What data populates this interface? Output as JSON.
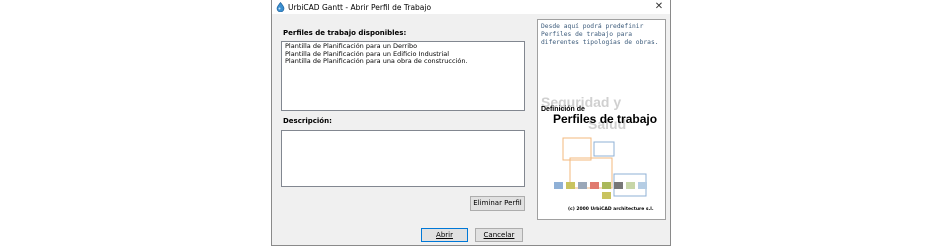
{
  "window": {
    "title": "UrbiCAD Gantt - Abrir Perfil de Trabajo",
    "close_glyph": "✕"
  },
  "profiles": {
    "label": "Perfiles de trabajo disponibles:",
    "items": [
      "Plantilla de Planificación para un Derribo",
      "Plantilla de Planificación para un Edificio Industrial",
      "Plantilla de Planificación para una obra de construcción."
    ]
  },
  "description": {
    "label": "Descripción:",
    "value": ""
  },
  "buttons": {
    "delete_profile": "Eliminar Perfil",
    "open": "Abrir",
    "cancel": "Cancelar"
  },
  "side_panel": {
    "hint": "Desde aquí podrá predefinir Perfiles de trabajo para diferentes tipologías de obras.",
    "watermark_line1": "Seguridad y",
    "watermark_line2": "Salud",
    "heading_small": "Definición de",
    "heading_large": "Perfiles de trabajo",
    "copyright": "(c) 2000 UrbiCAD architecture s.l."
  },
  "colors": {
    "window_bg": "#f0f0f0",
    "hint_text": "#3b5a7a",
    "default_button_border": "#0078d7",
    "diagram_orange": "#f3b87e",
    "diagram_blue": "#8fb0d6"
  },
  "icons": {
    "app": "urbicad-app-icon",
    "close": "close-icon"
  }
}
